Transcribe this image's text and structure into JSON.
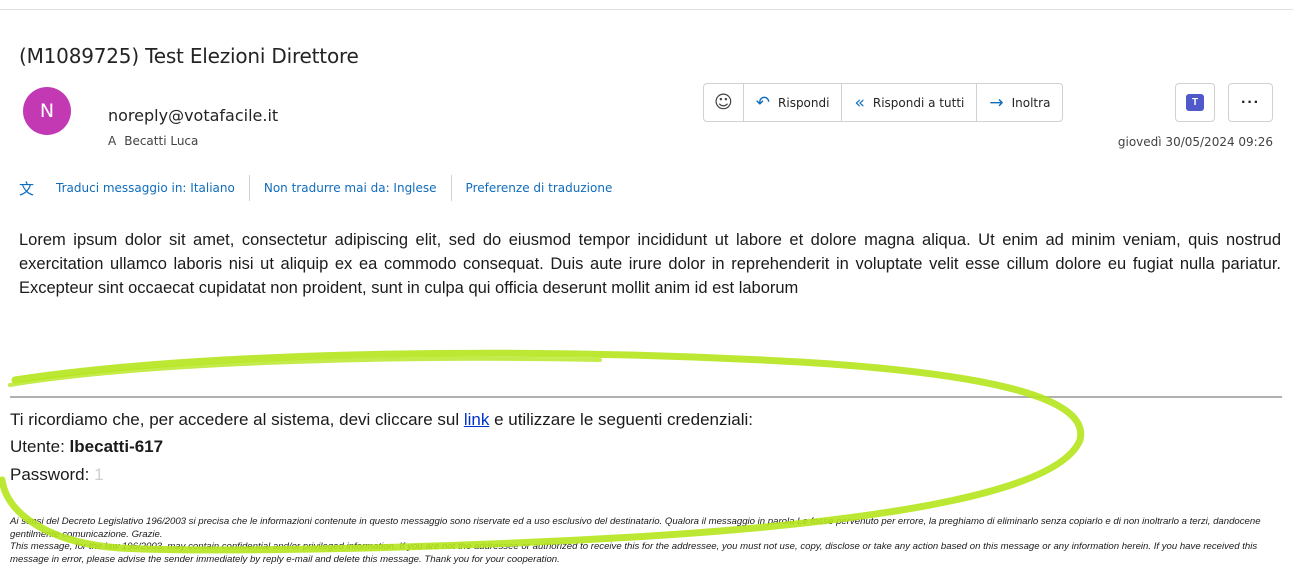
{
  "email": {
    "subject": "(M1089725) Test Elezioni Direttore",
    "avatar_initial": "N",
    "avatar_color": "#c239b3",
    "sender": "noreply@votafacile.it",
    "to_label": "A",
    "recipient": "Becatti Luca",
    "date": "giovedì 30/05/2024 09:26"
  },
  "actions": {
    "emoji_icon": "smiley-icon",
    "reply": "Rispondi",
    "reply_all": "Rispondi a tutti",
    "forward": "Inoltra",
    "teams_icon": "teams-icon",
    "more": "···"
  },
  "translate": {
    "translate_to": "Traduci messaggio in: Italiano",
    "never_translate": "Non tradurre mai da: Inglese",
    "preferences": "Preferenze di traduzione"
  },
  "body": {
    "paragraph": "Lorem ipsum dolor sit amet, consectetur adipiscing elit, sed do eiusmod tempor incididunt ut labore et dolore magna aliqua. Ut enim ad minim veniam, quis nostrud exercitation ullamco laboris nisi ut aliquip ex ea commodo consequat. Duis aute irure dolor in reprehenderit in voluptate velit esse cillum dolore eu fugiat nulla pariatur. Excepteur sint occaecat cupidatat non proident, sunt in culpa qui officia deserunt mollit anim id est laborum",
    "reminder_before": "Ti ricordiamo che, per accedere al sistema, devi cliccare sul ",
    "reminder_link": "link",
    "reminder_after": " e utilizzare le seguenti credenziali:",
    "user_label": "Utente: ",
    "user_value": "lbecatti-617",
    "password_label": "Password: ",
    "password_value": "1"
  },
  "disclaimer": {
    "italian": "Ai sensi del Decreto Legislativo 196/2003 si precisa che le informazioni contenute in questo messaggio sono riservate ed a uso esclusivo del destinatario. Qualora il messaggio in parola Le fosse pervenuto per errore, la preghiamo di eliminarlo senza copiarlo e di non inoltrarlo a terzi, dandocene gentilmente comunicazione. Grazie.",
    "english": "This message, for the law 196/2003, may contain confidential and/or privileged information. If you are not the addressee or authorized to receive this for the addressee, you must not use, copy, disclose or take any action based on this message or any information herein. If you have received this message in error, please advise the sender immediately by reply e-mail and delete this message. Thank you for your cooperation."
  },
  "annotation": {
    "highlight_color": "#b5e61d"
  }
}
